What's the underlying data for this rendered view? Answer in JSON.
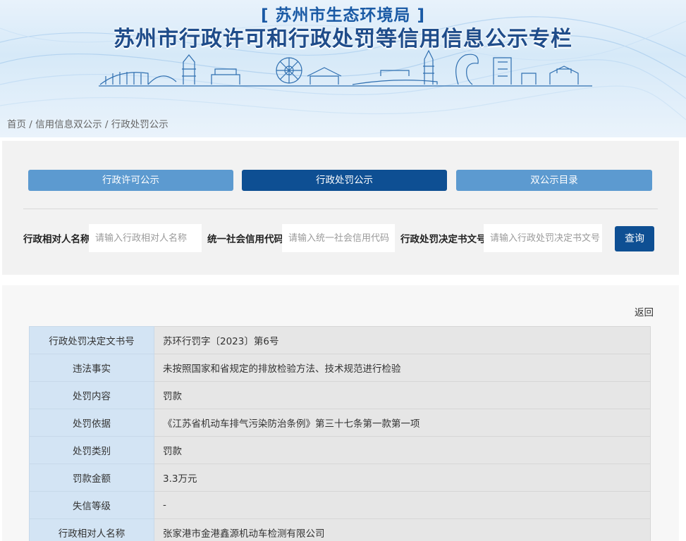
{
  "header": {
    "dept": "[ 苏州市生态环境局 ]",
    "title": "苏州市行政许可和行政处罚等信用信息公示专栏"
  },
  "breadcrumb": {
    "home": "首页",
    "sep1": " / ",
    "level2": "信用信息双公示",
    "sep2": " / ",
    "current": "行政处罚公示"
  },
  "tabs": [
    {
      "label": "行政许可公示",
      "active": false
    },
    {
      "label": "行政处罚公示",
      "active": true
    },
    {
      "label": "双公示目录",
      "active": false
    }
  ],
  "search": {
    "fields": [
      {
        "label": "行政相对人名称",
        "placeholder": "请输入行政相对人名称"
      },
      {
        "label": "统一社会信用代码",
        "placeholder": "请输入统一社会信用代码"
      },
      {
        "label": "行政处罚决定书文号",
        "placeholder": "请输入行政处罚决定书文号"
      }
    ],
    "button": "查询"
  },
  "detail": {
    "back": "返回",
    "rows": [
      {
        "key": "行政处罚决定文书号",
        "value": "苏环行罚字〔2023〕第6号"
      },
      {
        "key": "违法事实",
        "value": "未按照国家和省规定的排放检验方法、技术规范进行检验"
      },
      {
        "key": "处罚内容",
        "value": "罚款"
      },
      {
        "key": "处罚依据",
        "value": "《江苏省机动车排气污染防治条例》第三十七条第一款第一项"
      },
      {
        "key": "处罚类别",
        "value": "罚款"
      },
      {
        "key": "罚款金额",
        "value": "3.3万元"
      },
      {
        "key": "失信等级",
        "value": "-"
      },
      {
        "key": "行政相对人名称",
        "value": "张家港市金港鑫源机动车检测有限公司"
      }
    ]
  },
  "colors": {
    "primary": "#0e4f93",
    "tab_inactive": "#5c9ad0",
    "key_cell": "#d3e4f4",
    "value_cell": "#e6e6e6"
  }
}
